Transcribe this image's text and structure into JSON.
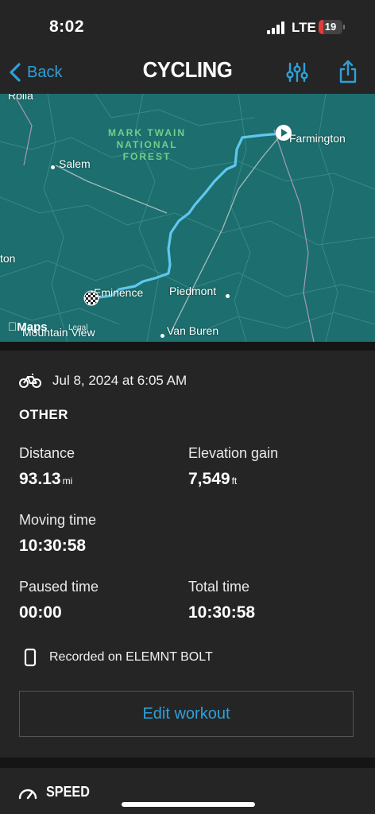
{
  "status_bar": {
    "time": "8:02",
    "network": "LTE",
    "battery": "19"
  },
  "nav": {
    "back_label": "Back",
    "title": "CYCLING",
    "back_icon": "chevron-left-icon",
    "filter_icon": "sliders-icon",
    "share_icon": "share-icon"
  },
  "map": {
    "places": {
      "rolla": "Rolla",
      "salem": "Salem",
      "farmington": "Farmington",
      "eminence": "Eminence",
      "piedmont": "Piedmont",
      "van_buren": "Van Buren",
      "mountain_view": "Mountain View",
      "left_edge": "ton"
    },
    "forest_lines": [
      "MARK TWAIN",
      "NATIONAL",
      "FOREST"
    ],
    "provider": "Maps",
    "legal": "Legal",
    "route_color": "#5ec8ee",
    "water_color": "#1d6e6e"
  },
  "workout": {
    "date": "Jul 8, 2024 at 6:05 AM",
    "type": "OTHER",
    "distance_label": "Distance",
    "distance_value": "93.13",
    "distance_unit": "mi",
    "elevation_label": "Elevation gain",
    "elevation_value": "7,549",
    "elevation_unit": "ft",
    "moving_label": "Moving time",
    "moving_value": "10:30:58",
    "paused_label": "Paused time",
    "paused_value": "00:00",
    "total_label": "Total time",
    "total_value": "10:30:58",
    "recorded": "Recorded on ELEMNT BOLT",
    "edit_label": "Edit workout"
  },
  "speed_section": {
    "label": "SPEED"
  },
  "colors": {
    "accent": "#2ea0d8",
    "card_bg": "#252525",
    "battery_low": "#e23b3b"
  }
}
